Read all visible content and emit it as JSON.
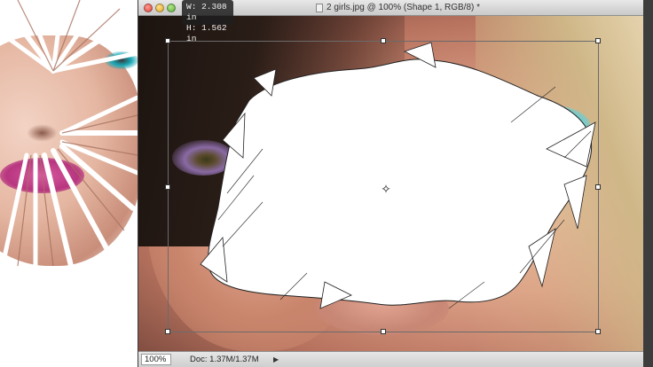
{
  "document": {
    "title": "2 girls.jpg @ 100% (Shape 1, RGB/8) *"
  },
  "transform_tooltip": {
    "width": "W: 2.308 in",
    "height": "H: 1.562 in"
  },
  "status_bar": {
    "zoom": "100%",
    "doc_size": "Doc: 1.37M/1.37M"
  },
  "colors": {
    "window_chrome": "#c9c9c9",
    "splat_fill": "#ffffff",
    "eye_accent": "#19b4c8",
    "lip_accent": "#d75aa0"
  },
  "icons": [
    "close-icon",
    "minimize-icon",
    "zoom-icon",
    "document-icon",
    "crosshair-icon",
    "status-menu-arrow-icon"
  ]
}
